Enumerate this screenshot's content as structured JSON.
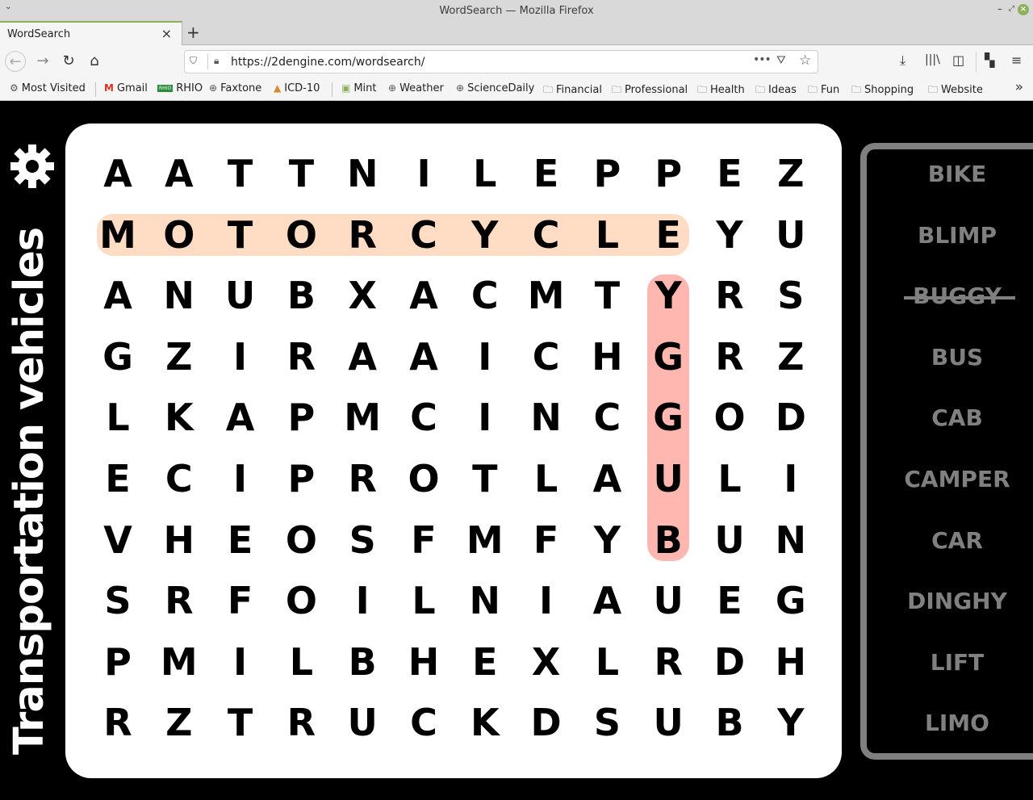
{
  "window": {
    "title": "WordSearch — Mozilla Firefox",
    "controls": [
      "minimize",
      "maximize",
      "close"
    ]
  },
  "tabs": [
    {
      "label": "WordSearch",
      "active": true
    }
  ],
  "navbar": {
    "url": "https://2dengine.com/wordsearch/"
  },
  "bookmarks": [
    {
      "label": "Most Visited",
      "icon": "gear-icon"
    },
    {
      "label": "Gmail",
      "icon": "gmail-icon"
    },
    {
      "label": "RHIO",
      "icon": "rhio-icon"
    },
    {
      "label": "Faxtone",
      "icon": "globe-icon"
    },
    {
      "label": "ICD-10",
      "icon": "icd-icon"
    },
    {
      "label": "Mint",
      "icon": "mint-icon"
    },
    {
      "label": "Weather",
      "icon": "globe-icon"
    },
    {
      "label": "ScienceDaily",
      "icon": "globe-icon"
    },
    {
      "label": "Financial",
      "icon": "folder-icon"
    },
    {
      "label": "Professional",
      "icon": "folder-icon"
    },
    {
      "label": "Health",
      "icon": "folder-icon"
    },
    {
      "label": "Ideas",
      "icon": "folder-icon"
    },
    {
      "label": "Fun",
      "icon": "folder-icon"
    },
    {
      "label": "Shopping",
      "icon": "folder-icon"
    },
    {
      "label": "Website",
      "icon": "folder-icon"
    }
  ],
  "game": {
    "category_title": "Transportation vehicles",
    "grid": [
      [
        "A",
        "A",
        "T",
        "T",
        "N",
        "I",
        "L",
        "E",
        "P",
        "P",
        "E",
        "Z"
      ],
      [
        "M",
        "O",
        "T",
        "O",
        "R",
        "C",
        "Y",
        "C",
        "L",
        "E",
        "Y",
        "U"
      ],
      [
        "A",
        "N",
        "U",
        "B",
        "X",
        "A",
        "C",
        "M",
        "T",
        "Y",
        "R",
        "S"
      ],
      [
        "G",
        "Z",
        "I",
        "R",
        "A",
        "A",
        "I",
        "C",
        "H",
        "G",
        "R",
        "Z"
      ],
      [
        "L",
        "K",
        "A",
        "P",
        "M",
        "C",
        "I",
        "N",
        "C",
        "G",
        "O",
        "D"
      ],
      [
        "E",
        "C",
        "I",
        "P",
        "R",
        "O",
        "T",
        "L",
        "A",
        "U",
        "L",
        "I"
      ],
      [
        "V",
        "H",
        "E",
        "O",
        "S",
        "F",
        "M",
        "F",
        "Y",
        "B",
        "U",
        "N"
      ],
      [
        "S",
        "R",
        "F",
        "O",
        "I",
        "L",
        "N",
        "I",
        "A",
        "U",
        "E",
        "G"
      ],
      [
        "P",
        "M",
        "I",
        "L",
        "B",
        "H",
        "E",
        "X",
        "L",
        "R",
        "D",
        "H"
      ],
      [
        "R",
        "Z",
        "T",
        "R",
        "U",
        "C",
        "K",
        "D",
        "S",
        "U",
        "B",
        "Y"
      ]
    ],
    "highlights": [
      {
        "word": "MOTORCYCLE",
        "start": [
          1,
          0
        ],
        "end": [
          1,
          9
        ],
        "color": "#ffdcc3",
        "found": false
      },
      {
        "word": "BUGGY",
        "start": [
          6,
          9
        ],
        "end": [
          2,
          9
        ],
        "color": "#ffb7b0",
        "found": true
      }
    ],
    "words": [
      {
        "label": "BIKE",
        "found": false
      },
      {
        "label": "BLIMP",
        "found": false
      },
      {
        "label": "BUGGY",
        "found": true
      },
      {
        "label": "BUS",
        "found": false
      },
      {
        "label": "CAB",
        "found": false
      },
      {
        "label": "CAMPER",
        "found": false
      },
      {
        "label": "CAR",
        "found": false
      },
      {
        "label": "DINGHY",
        "found": false
      },
      {
        "label": "LIFT",
        "found": false
      },
      {
        "label": "LIMO",
        "found": false
      }
    ]
  }
}
